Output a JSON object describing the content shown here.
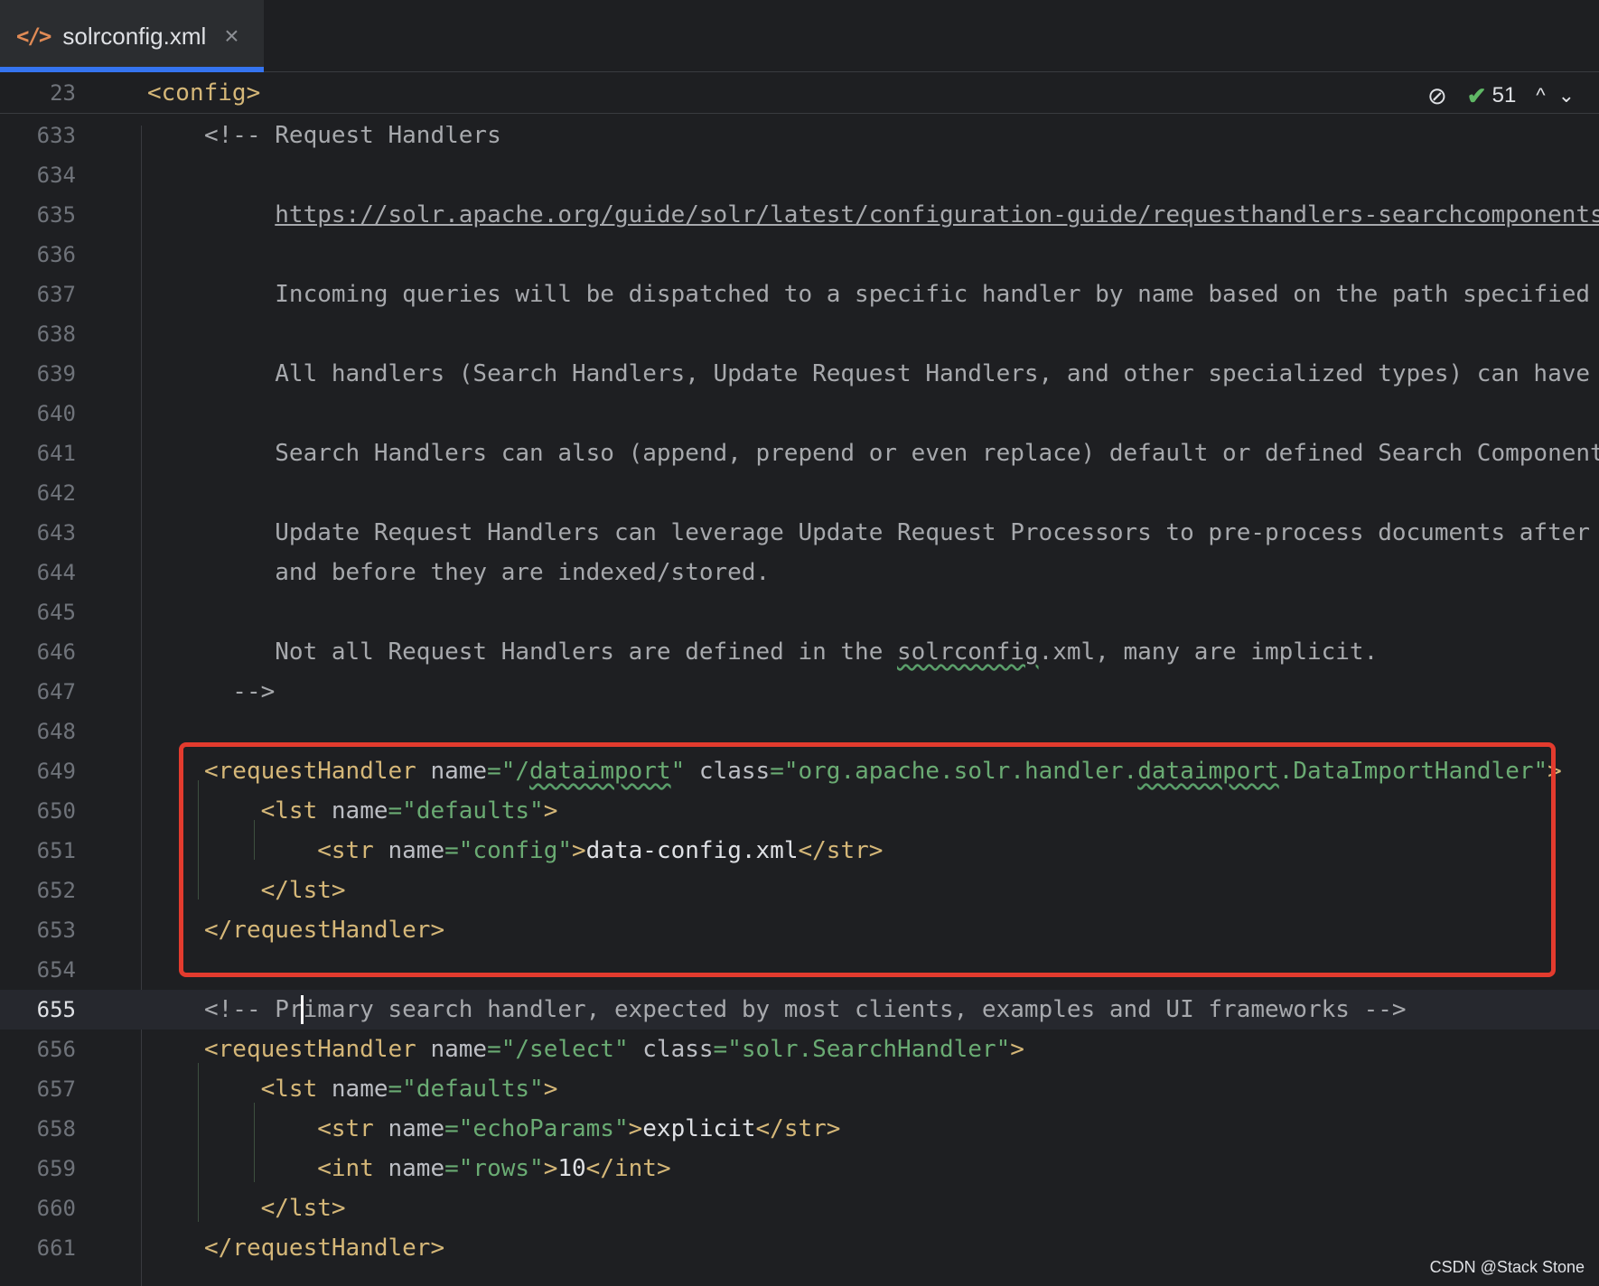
{
  "tab": {
    "icon": "xml-code-icon",
    "title": "solrconfig.xml",
    "close": "×"
  },
  "breadcrumb": {
    "line": "23",
    "tag": "<config>"
  },
  "inspection": {
    "eye_icon": "hidden-eye-icon",
    "check_icon": "check-icon",
    "count": "51",
    "up": "^",
    "down": "⌄"
  },
  "lines": [
    {
      "n": "633",
      "spans": [
        {
          "t": "<!-- Request Handlers",
          "c": "cmt"
        }
      ]
    },
    {
      "n": "634",
      "spans": []
    },
    {
      "n": "635",
      "spans": [
        {
          "t": "     ",
          "c": "cmt"
        },
        {
          "t": "https://solr.apache.org/guide/solr/latest/configuration-guide/requesthandlers-searchcomponents",
          "c": "lnk"
        }
      ]
    },
    {
      "n": "636",
      "spans": []
    },
    {
      "n": "637",
      "spans": [
        {
          "t": "     Incoming queries will be dispatched to a specific handler by name based on the path specified",
          "c": "cmt"
        }
      ]
    },
    {
      "n": "638",
      "spans": []
    },
    {
      "n": "639",
      "spans": [
        {
          "t": "     All handlers (Search Handlers, Update Request Handlers, and other specialized types) can have",
          "c": "cmt"
        }
      ]
    },
    {
      "n": "640",
      "spans": []
    },
    {
      "n": "641",
      "spans": [
        {
          "t": "     Search Handlers can also (append, prepend or even replace) default or defined Search Component",
          "c": "cmt"
        }
      ]
    },
    {
      "n": "642",
      "spans": []
    },
    {
      "n": "643",
      "spans": [
        {
          "t": "     Update Request Handlers can leverage Update Request Processors to pre-process documents after",
          "c": "cmt"
        }
      ]
    },
    {
      "n": "644",
      "spans": [
        {
          "t": "     and before they are indexed/stored.",
          "c": "cmt"
        }
      ]
    },
    {
      "n": "645",
      "spans": []
    },
    {
      "n": "646",
      "spans": [
        {
          "t": "     Not all Request Handlers are defined in the ",
          "c": "cmt"
        },
        {
          "t": "solrconfig",
          "c": "cmt sq"
        },
        {
          "t": ".xml, many are implicit.",
          "c": "cmt"
        }
      ]
    },
    {
      "n": "647",
      "spans": [
        {
          "t": "  -->",
          "c": "cmt"
        }
      ]
    },
    {
      "n": "648",
      "spans": []
    },
    {
      "n": "649",
      "spans": [
        {
          "t": "<requestHandler ",
          "c": "tag"
        },
        {
          "t": "name",
          "c": "attr"
        },
        {
          "t": "=\"/",
          "c": "val"
        },
        {
          "t": "dataimport",
          "c": "val sq"
        },
        {
          "t": "\" ",
          "c": "val"
        },
        {
          "t": "class",
          "c": "attr"
        },
        {
          "t": "=\"org.apache.solr.handler.",
          "c": "val"
        },
        {
          "t": "dataimport",
          "c": "val sq"
        },
        {
          "t": ".DataImportHandler\"",
          "c": "val"
        },
        {
          "t": ">",
          "c": "tag"
        }
      ]
    },
    {
      "n": "650",
      "spans": [
        {
          "t": "    <lst ",
          "c": "tag"
        },
        {
          "t": "name",
          "c": "attr"
        },
        {
          "t": "=\"defaults\"",
          "c": "val"
        },
        {
          "t": ">",
          "c": "tag"
        }
      ]
    },
    {
      "n": "651",
      "spans": [
        {
          "t": "        <str ",
          "c": "tag"
        },
        {
          "t": "name",
          "c": "attr"
        },
        {
          "t": "=\"config\"",
          "c": "val"
        },
        {
          "t": ">",
          "c": "tag"
        },
        {
          "t": "data-config.xml",
          "c": "txt"
        },
        {
          "t": "</str>",
          "c": "tag"
        }
      ]
    },
    {
      "n": "652",
      "spans": [
        {
          "t": "    </lst>",
          "c": "tag"
        }
      ]
    },
    {
      "n": "653",
      "spans": [
        {
          "t": "</requestHandler>",
          "c": "tag"
        }
      ]
    },
    {
      "n": "654",
      "spans": []
    },
    {
      "n": "655",
      "current": true,
      "spans": [
        {
          "t": "<!-- Primary search handler, expected by most clients, examples and UI frameworks -->",
          "c": "cmt"
        }
      ]
    },
    {
      "n": "656",
      "spans": [
        {
          "t": "<requestHandler ",
          "c": "tag"
        },
        {
          "t": "name",
          "c": "attr"
        },
        {
          "t": "=\"/select\" ",
          "c": "val"
        },
        {
          "t": "class",
          "c": "attr"
        },
        {
          "t": "=\"solr.SearchHandler\"",
          "c": "val"
        },
        {
          "t": ">",
          "c": "tag"
        }
      ]
    },
    {
      "n": "657",
      "spans": [
        {
          "t": "    <lst ",
          "c": "tag"
        },
        {
          "t": "name",
          "c": "attr"
        },
        {
          "t": "=\"defaults\"",
          "c": "val"
        },
        {
          "t": ">",
          "c": "tag"
        }
      ]
    },
    {
      "n": "658",
      "spans": [
        {
          "t": "        <str ",
          "c": "tag"
        },
        {
          "t": "name",
          "c": "attr"
        },
        {
          "t": "=\"echoParams\"",
          "c": "val"
        },
        {
          "t": ">",
          "c": "tag"
        },
        {
          "t": "explicit",
          "c": "txt"
        },
        {
          "t": "</str>",
          "c": "tag"
        }
      ]
    },
    {
      "n": "659",
      "spans": [
        {
          "t": "        <int ",
          "c": "tag"
        },
        {
          "t": "name",
          "c": "attr"
        },
        {
          "t": "=\"rows\"",
          "c": "val"
        },
        {
          "t": ">",
          "c": "tag"
        },
        {
          "t": "10",
          "c": "txt"
        },
        {
          "t": "</int>",
          "c": "tag"
        }
      ]
    },
    {
      "n": "660",
      "spans": [
        {
          "t": "    </lst>",
          "c": "tag"
        }
      ]
    },
    {
      "n": "661",
      "spans": [
        {
          "t": "</requestHandler>",
          "c": "tag"
        }
      ]
    }
  ],
  "watermark": "CSDN @Stack Stone"
}
